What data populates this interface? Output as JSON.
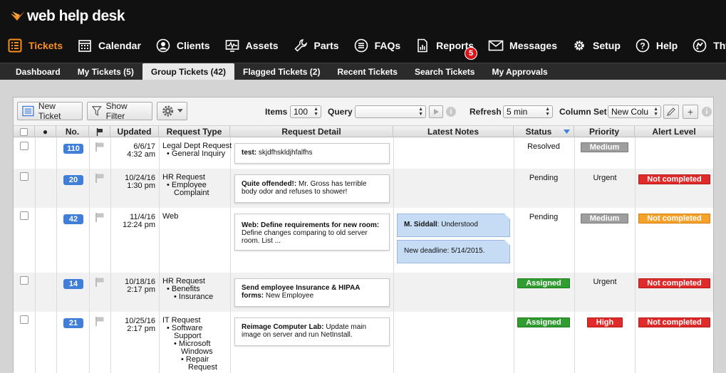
{
  "app": {
    "logo_text": "web help desk"
  },
  "main_nav": [
    {
      "label": "Tickets",
      "icon": "list-icon",
      "active": true
    },
    {
      "label": "Calendar",
      "icon": "calendar-icon"
    },
    {
      "label": "Clients",
      "icon": "user-icon"
    },
    {
      "label": "Assets",
      "icon": "monitor-icon"
    },
    {
      "label": "Parts",
      "icon": "wrench-icon"
    },
    {
      "label": "FAQs",
      "icon": "faq-list-icon"
    },
    {
      "label": "Reports",
      "icon": "report-icon"
    },
    {
      "label": "Messages",
      "icon": "envelope-icon",
      "badge": "5"
    },
    {
      "label": "Setup",
      "icon": "gear-icon"
    },
    {
      "label": "Help",
      "icon": "question-icon"
    },
    {
      "label": "Thwack",
      "icon": "thwack-icon"
    }
  ],
  "sub_nav": [
    {
      "label": "Dashboard"
    },
    {
      "label": "My Tickets (5)"
    },
    {
      "label": "Group Tickets (42)",
      "active": true
    },
    {
      "label": "Flagged Tickets (2)"
    },
    {
      "label": "Recent Tickets"
    },
    {
      "label": "Search Tickets"
    },
    {
      "label": "My Approvals"
    }
  ],
  "toolbar": {
    "new_ticket": "New Ticket",
    "show_filter": "Show Filter",
    "items_label": "Items",
    "items_value": "100",
    "query_label": "Query",
    "query_value": "",
    "refresh_label": "Refresh",
    "refresh_value": "5 min",
    "column_set_label": "Column Set",
    "column_set_value": "New Colu"
  },
  "columns": {
    "no": "No.",
    "updated": "Updated",
    "request_type": "Request Type",
    "request_detail": "Request Detail",
    "latest_notes": "Latest Notes",
    "status": "Status",
    "priority": "Priority",
    "alert_level": "Alert Level"
  },
  "tickets": [
    {
      "no": "110",
      "updated_date": "6/6/17",
      "updated_time": "4:32 am",
      "type_lines": [
        "Legal Dept Request",
        "• General Inquiry"
      ],
      "detail_title": "test:",
      "detail_text": " skjdfhskldjhfalfhs",
      "notes": [],
      "status": "Resolved",
      "priority": "Medium",
      "alert": ""
    },
    {
      "no": "20",
      "updated_date": "10/24/16",
      "updated_time": "1:30 pm",
      "type_lines": [
        "HR Request",
        "• Employee",
        "Complaint"
      ],
      "detail_title": "Quite offended!:",
      "detail_text": " Mr. Gross has terrible body odor and refuses to shower!",
      "notes": [],
      "status": "Pending",
      "priority": "Urgent",
      "alert": "Not completed"
    },
    {
      "no": "42",
      "updated_date": "11/4/16",
      "updated_time": "12:24 pm",
      "type_lines": [
        "Web"
      ],
      "detail_title": "Web: Define requirements for new room:",
      "detail_text": " Define changes comparing to old server room. List ...",
      "notes": [
        {
          "author": "M. Siddall",
          "text": ": Understood"
        },
        {
          "author": "",
          "text": "New deadline: 5/14/2015."
        }
      ],
      "status": "Pending",
      "priority": "Medium",
      "alert": "Not completed"
    },
    {
      "no": "14",
      "updated_date": "10/18/16",
      "updated_time": "2:17 pm",
      "type_lines": [
        "HR Request",
        "• Benefits",
        "• Insurance"
      ],
      "detail_title": "Send employee Insurance & HIPAA forms:",
      "detail_text": " New Employee",
      "notes": [],
      "status": "Assigned",
      "priority": "Urgent",
      "alert": "Not completed"
    },
    {
      "no": "21",
      "updated_date": "10/25/16",
      "updated_time": "2:17 pm",
      "type_lines": [
        "IT Request",
        "• Software",
        "Support",
        "• Microsoft",
        "Windows",
        "• Repair",
        "Request"
      ],
      "detail_title": "Reimage Computer Lab:",
      "detail_text": " Update main image on server and run NetInstall.",
      "notes": [],
      "status": "Assigned",
      "priority": "High",
      "alert": "Not completed"
    }
  ],
  "colors": {
    "accent_orange": "#f78f1e",
    "badge_blue": "#3f7fd9",
    "assigned_green": "#2f9d2f",
    "alert_red": "#e02b2b",
    "alert_orange": "#f5a12a",
    "medium_gray": "#9e9e9e",
    "note_blue": "#c6dcf5"
  }
}
